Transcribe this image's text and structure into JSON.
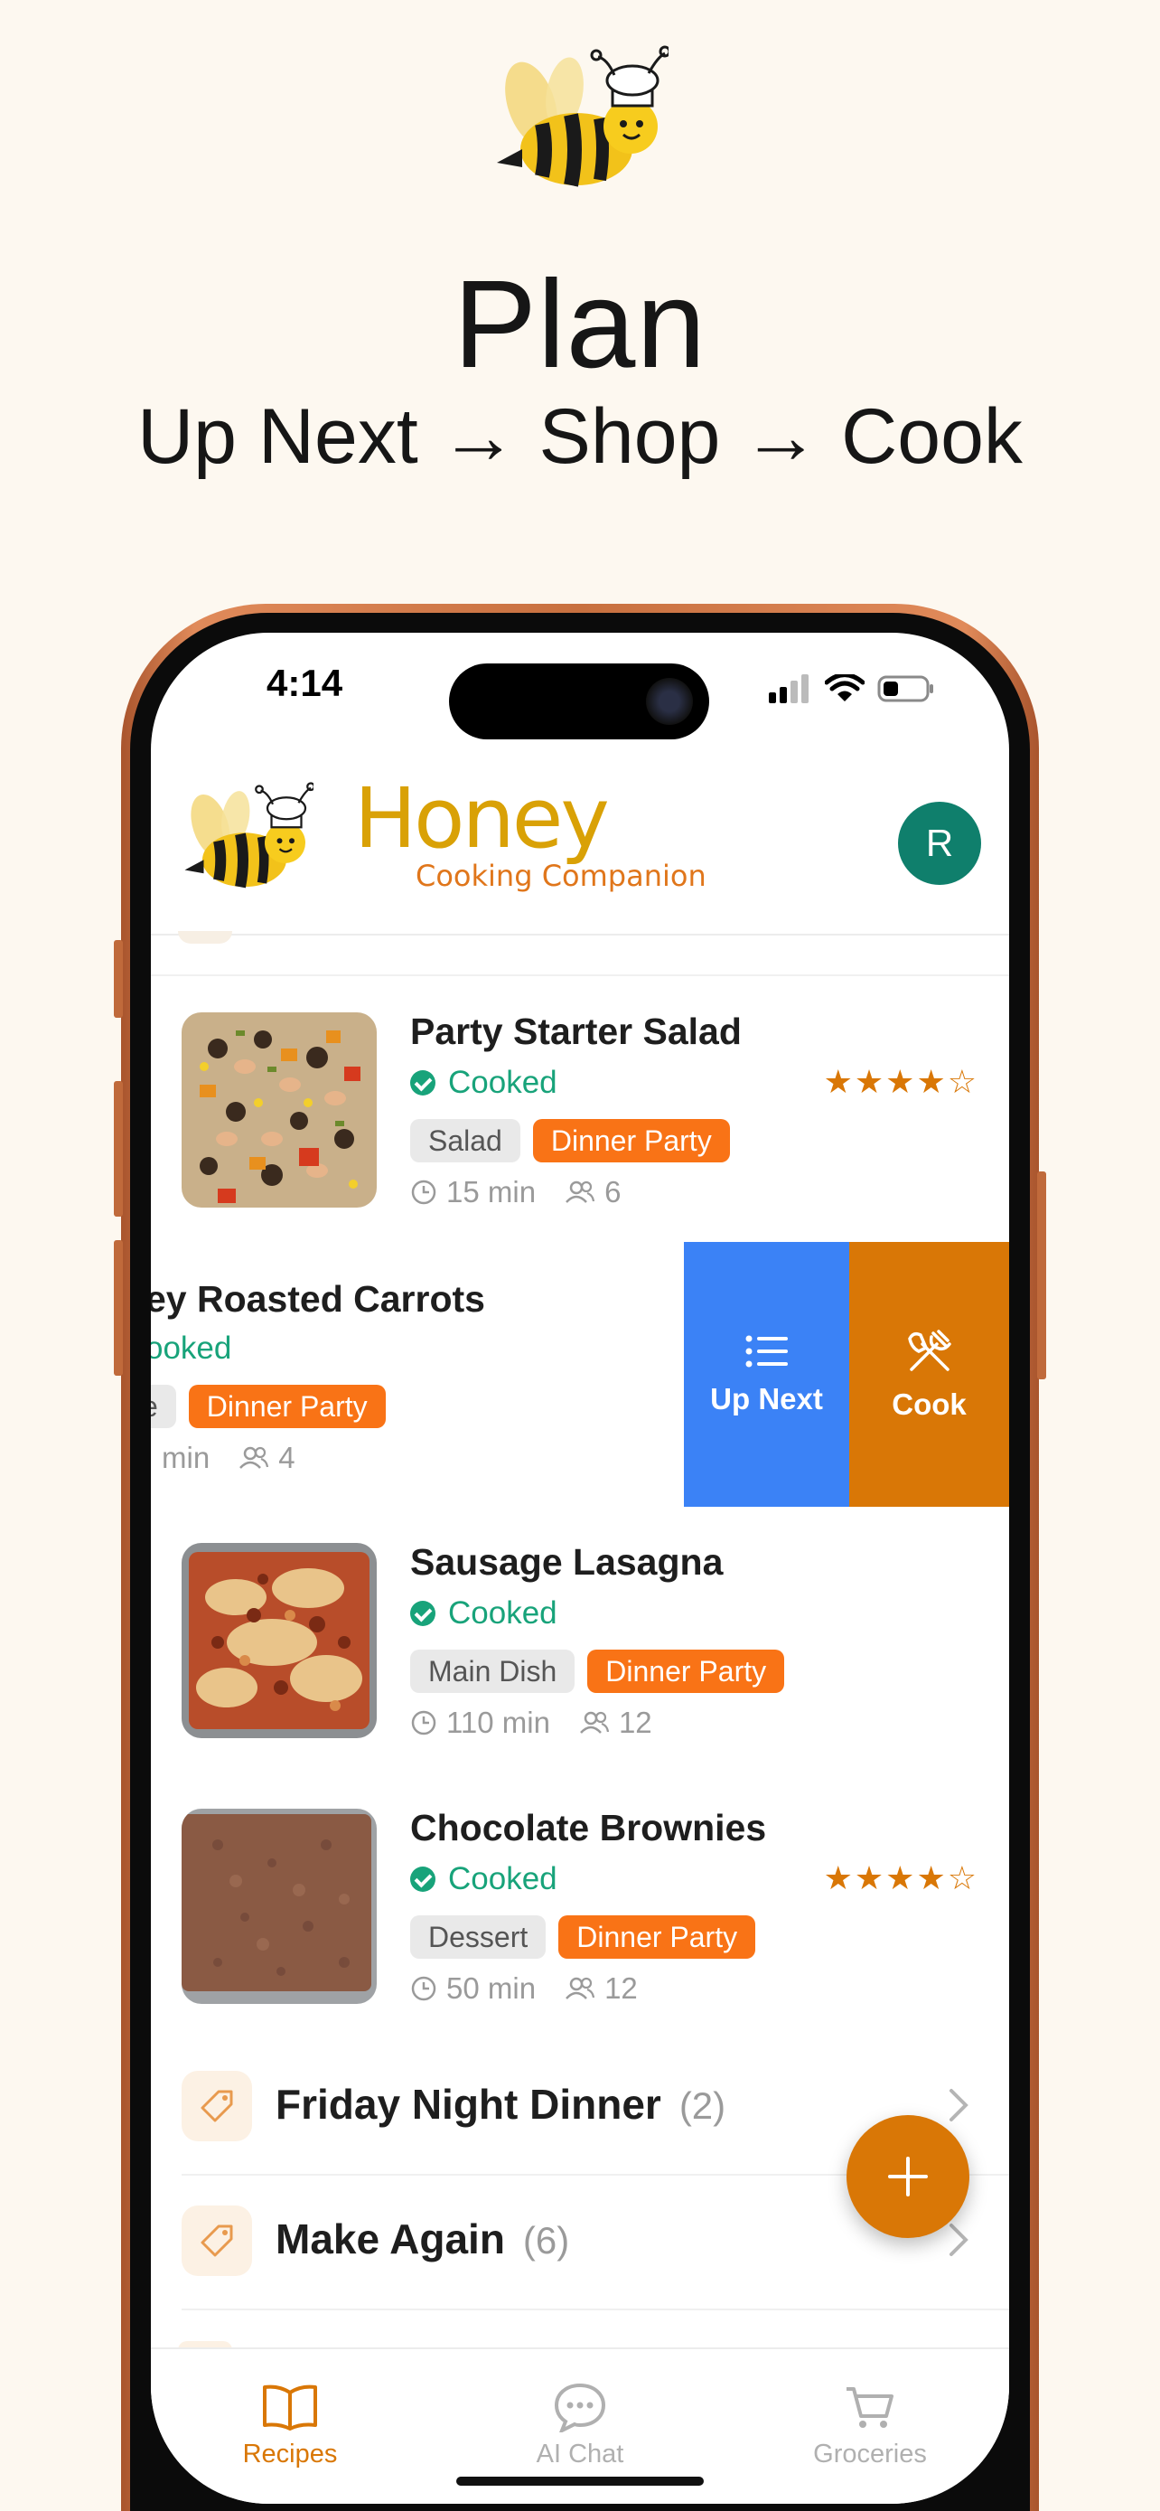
{
  "hero": {
    "title": "Plan",
    "subtitle": "Up Next →  Shop → Cook"
  },
  "status_bar": {
    "time": "4:14"
  },
  "header": {
    "brand_name": "Honey",
    "brand_tagline": "Cooking Companion",
    "avatar_initial": "R"
  },
  "recipes": [
    {
      "title": "Party Starter Salad",
      "status": "Cooked",
      "tags": [
        "Salad",
        "Dinner Party"
      ],
      "time": "15 min",
      "servings": "6",
      "rating": 4
    },
    {
      "title": "ey Roasted Carrots",
      "status": "ooked",
      "tags": [
        "e",
        "Dinner Party"
      ],
      "time": "min",
      "servings": "4"
    },
    {
      "title": "Sausage Lasagna",
      "status": "Cooked",
      "tags": [
        "Main Dish",
        "Dinner Party"
      ],
      "time": "110 min",
      "servings": "12"
    },
    {
      "title": "Chocolate Brownies",
      "status": "Cooked",
      "tags": [
        "Dessert",
        "Dinner Party"
      ],
      "time": "50 min",
      "servings": "12",
      "rating": 4
    }
  ],
  "swipe_actions": {
    "up_next": "Up Next",
    "cook": "Cook"
  },
  "folders": [
    {
      "name": "Friday Night Dinner",
      "count": "(2)"
    },
    {
      "name": "Make Again",
      "count": "(6)"
    }
  ],
  "tabbar": {
    "recipes": "Recipes",
    "ai_chat": "AI Chat",
    "groceries": "Groceries",
    "active": "Recipes"
  },
  "colors": {
    "accent": "#d97706",
    "tag_orange": "#f97316",
    "cooked_green": "#18a37a",
    "up_next_blue": "#3b82f6",
    "avatar": "#0f7f6c",
    "background": "#fdf8f0"
  }
}
